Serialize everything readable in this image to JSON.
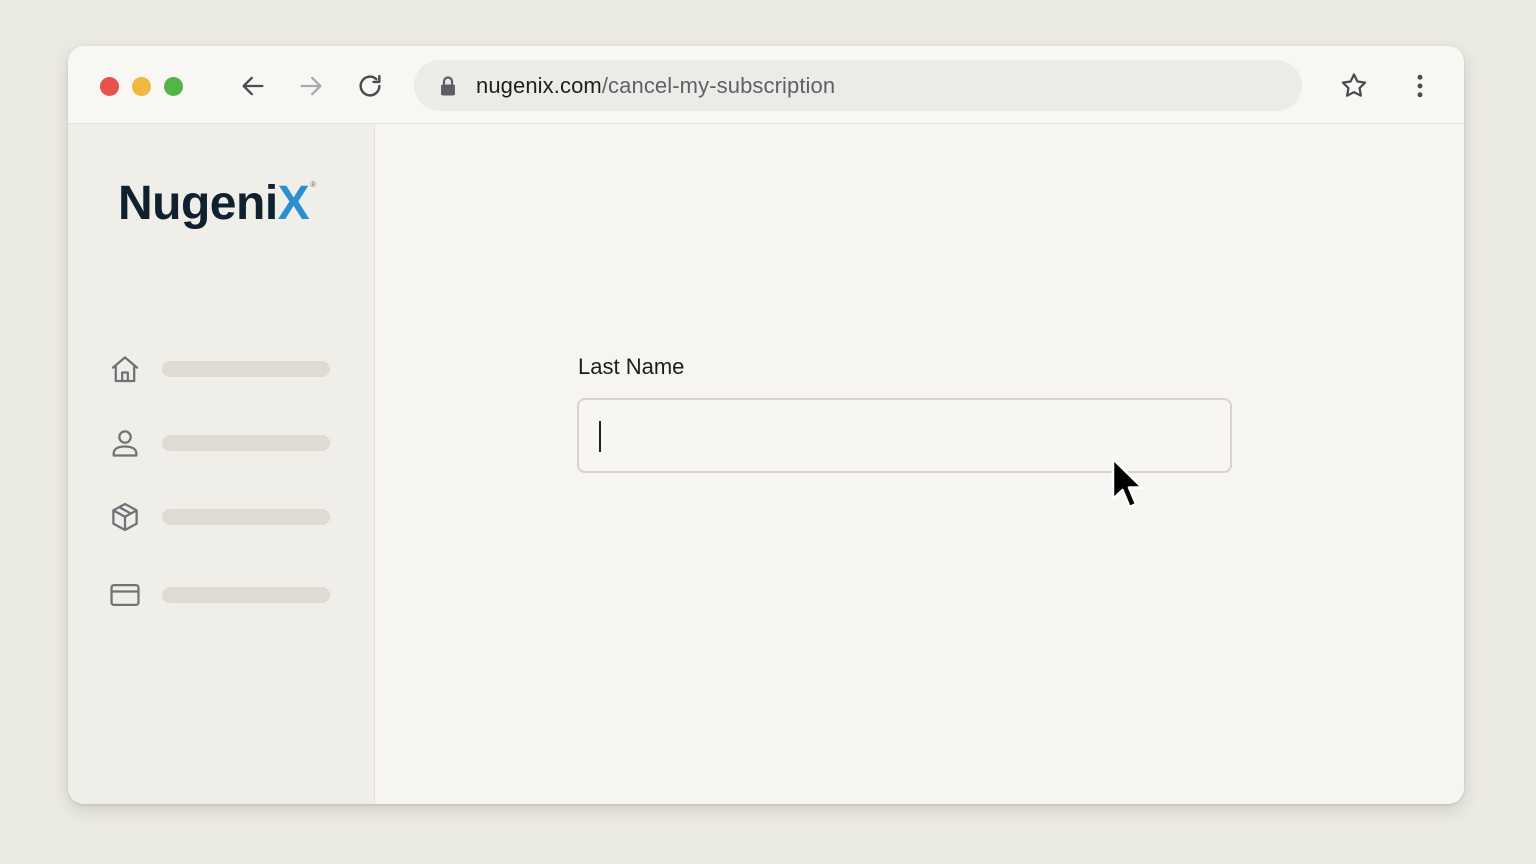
{
  "browser": {
    "traffic_lights": {
      "close_color": "#e8524a",
      "minimize_color": "#f0b83e",
      "maximize_color": "#52b54a"
    },
    "toolbar_icons": [
      "arrow-left-icon",
      "arrow-right-icon",
      "reload-icon",
      "star-icon",
      "kebab-menu-icon"
    ],
    "address_bar": {
      "domain": "nugenix.com",
      "path": "/cancel-my-subscription",
      "lock_icon": "lock-icon"
    }
  },
  "sidebar": {
    "logo": {
      "main": "Nugeni",
      "accent": "X",
      "registered": "®",
      "accent_color": "#2a8fd0",
      "text_color": "#10202e"
    },
    "nav_items": [
      {
        "icon": "home-icon"
      },
      {
        "icon": "user-icon"
      },
      {
        "icon": "package-icon"
      },
      {
        "icon": "credit-card-icon"
      }
    ]
  },
  "form": {
    "last_name": {
      "label": "Last Name",
      "value": "",
      "placeholder": ""
    }
  }
}
